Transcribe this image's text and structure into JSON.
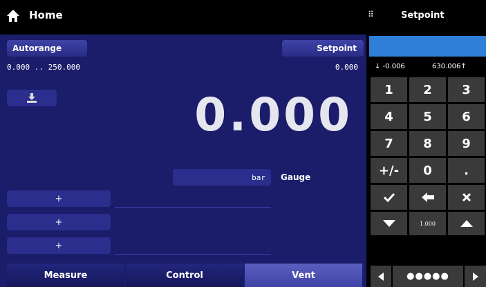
{
  "header": {
    "title": "Home"
  },
  "left_panel": {
    "autorange_label": "Autorange",
    "setpoint_label": "Setpoint",
    "range_text": "0.000 .. 250.000",
    "setpoint_value": "0.000",
    "reading": "0.000",
    "units": "bar",
    "mode": "Gauge",
    "plus_buttons": [
      "+",
      "+",
      "+"
    ]
  },
  "tabs": [
    {
      "label": "Measure",
      "active": false
    },
    {
      "label": "Control",
      "active": false
    },
    {
      "label": "Vent",
      "active": true
    }
  ],
  "keypad": {
    "title": "Setpoint",
    "min": "↓ -0.006",
    "max": "630.006↑",
    "keys": [
      "1",
      "2",
      "3",
      "4",
      "5",
      "6",
      "7",
      "8",
      "9",
      "+/-",
      "0",
      "."
    ],
    "confirm_icon": "check-icon",
    "backspace_icon": "left-arrow-icon",
    "cancel_icon": "close-icon",
    "step_value": "1.000",
    "pager": "●●●●●"
  },
  "colors": {
    "panel_bg": "#1b1d6b",
    "entry_blue": "#2f7fd6",
    "key_gray": "#3a3a3a"
  }
}
